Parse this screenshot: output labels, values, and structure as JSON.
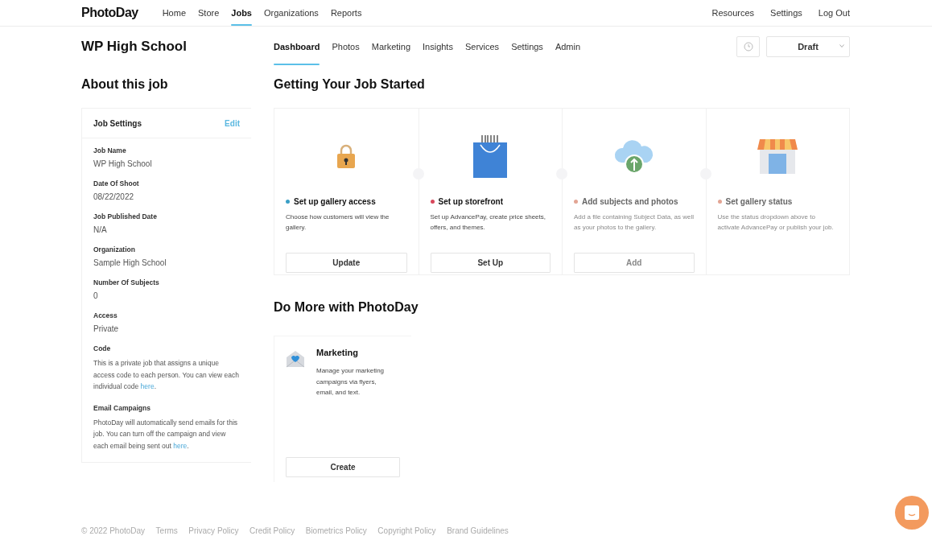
{
  "header": {
    "logo": "PhotoDay",
    "nav": [
      {
        "label": "Home",
        "selected": false
      },
      {
        "label": "Store",
        "selected": false
      },
      {
        "label": "Jobs",
        "selected": true
      },
      {
        "label": "Organizations",
        "selected": false
      },
      {
        "label": "Reports",
        "selected": false
      }
    ],
    "right_nav": [
      "Resources",
      "Settings",
      "Log Out"
    ]
  },
  "job_title": "WP High School",
  "tabs": [
    {
      "label": "Dashboard",
      "selected": true
    },
    {
      "label": "Photos",
      "selected": false
    },
    {
      "label": "Marketing",
      "selected": false
    },
    {
      "label": "Insights",
      "selected": false
    },
    {
      "label": "Services",
      "selected": false
    },
    {
      "label": "Settings",
      "selected": false
    },
    {
      "label": "Admin",
      "selected": false
    }
  ],
  "status_select": {
    "value": "Draft"
  },
  "about": {
    "heading": "About this job",
    "card_title": "Job Settings",
    "edit_link": "Edit",
    "fields": [
      {
        "kind": "value",
        "label": "Job Name",
        "value": "WP High School"
      },
      {
        "kind": "value",
        "label": "Date Of Shoot",
        "value": "08/22/2022"
      },
      {
        "kind": "value",
        "label": "Job Published Date",
        "value": "N/A"
      },
      {
        "kind": "value",
        "label": "Organization",
        "value": "Sample High School"
      },
      {
        "kind": "value",
        "label": "Number Of Subjects",
        "value": "0"
      },
      {
        "kind": "value",
        "label": "Access",
        "value": "Private"
      },
      {
        "kind": "note",
        "label": "Code",
        "text": "This is a private job that assigns a unique access code to each person. You can view each individual code ",
        "link": "here",
        "text_after": "."
      },
      {
        "kind": "note",
        "label": "Email Campaigns",
        "text": "PhotoDay will automatically send emails for this job. You can turn off the campaign and view each email being sent out ",
        "link": "here",
        "text_after": "."
      }
    ]
  },
  "getting_started": {
    "heading": "Getting Your Job Started",
    "steps": [
      {
        "kind": "access",
        "color": "#3a9fc6",
        "title": "Set up gallery access",
        "description": "Choose how customers will view the gallery.",
        "button": "Update",
        "disabled": false
      },
      {
        "kind": "storefront",
        "color": "#d8485c",
        "title": "Set up storefront",
        "description": "Set up AdvancePay, create price sheets, offers, and themes.",
        "button": "Set Up",
        "disabled": false
      },
      {
        "kind": "upload",
        "color": "#e3a594",
        "title": "Add subjects and photos",
        "description": "Add a file containing Subject Data, as well as your photos to the gallery.",
        "button": "Add",
        "disabled": true
      },
      {
        "kind": "status",
        "color": "#e3a594",
        "title": "Set gallery status",
        "description": "Use the status dropdown above to activate AdvancePay or publish your job.",
        "disabled": true
      }
    ]
  },
  "do_more": {
    "heading": "Do More with PhotoDay",
    "cards": [
      {
        "title": "Marketing",
        "description": "Manage your marketing campaigns via flyers, email, and text.",
        "button": "Create"
      }
    ]
  },
  "footer": [
    "© 2022 PhotoDay",
    "Terms",
    "Privacy Policy",
    "Credit Policy",
    "Biometrics Policy",
    "Copyright Policy",
    "Brand Guidelines"
  ]
}
